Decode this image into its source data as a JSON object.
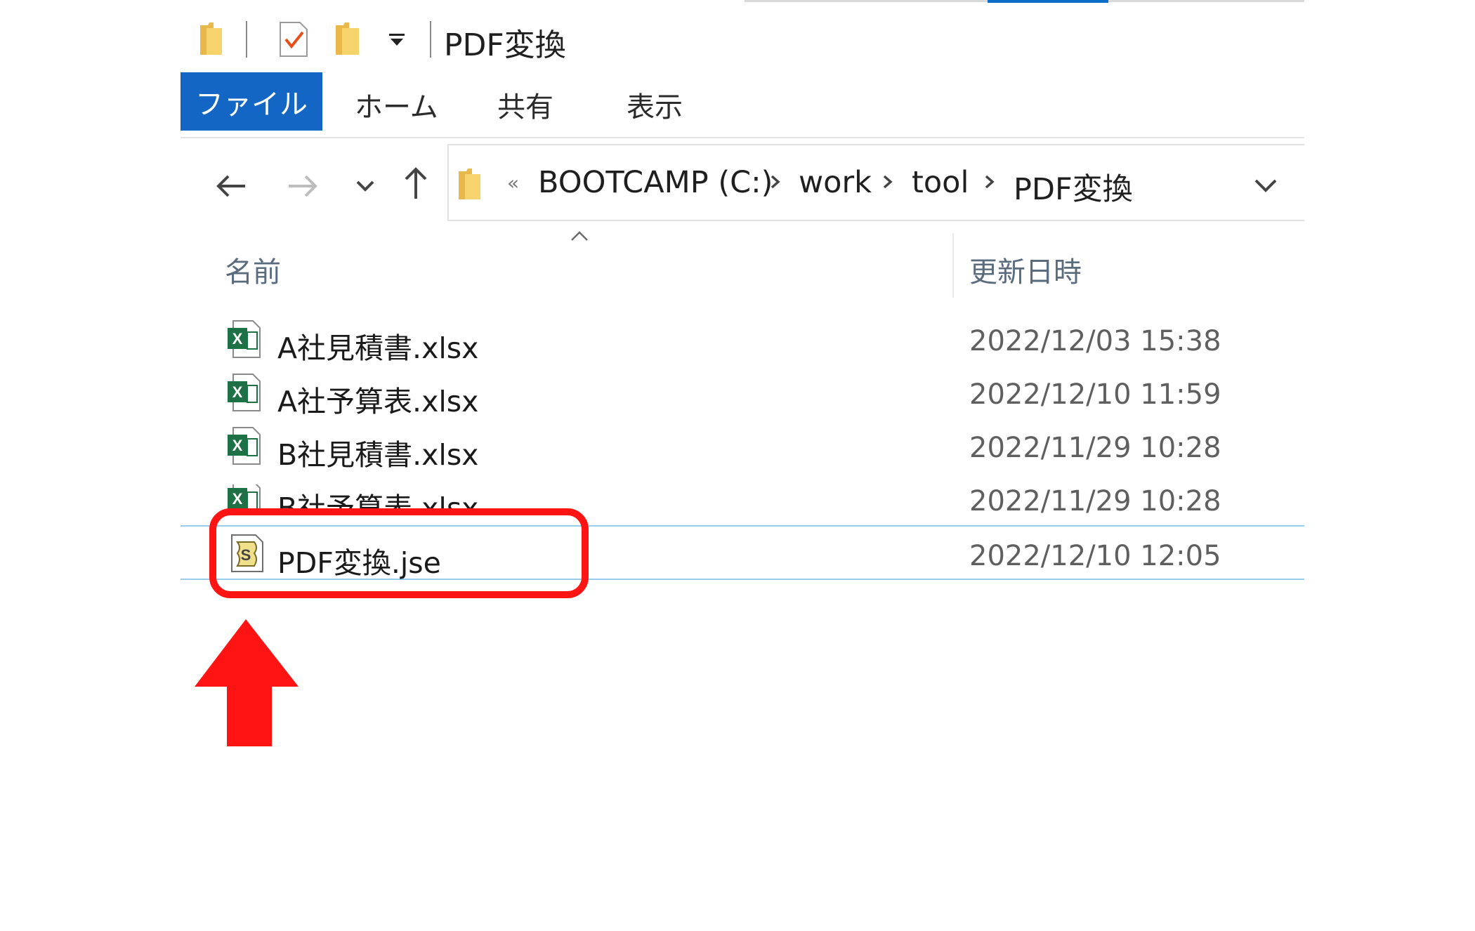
{
  "window": {
    "title": "PDF変換",
    "colors": {
      "accent": "#1366c3",
      "highlight": "#ff1414",
      "selection_border": "#99cdf0"
    }
  },
  "quick_access": {
    "icons": [
      "folder-icon",
      "properties-check-icon",
      "new-folder-icon",
      "dropdown-caret-icon"
    ]
  },
  "ribbon": {
    "tabs": [
      {
        "label": "ファイル",
        "active": true
      },
      {
        "label": "ホーム"
      },
      {
        "label": "共有"
      },
      {
        "label": "表示"
      }
    ]
  },
  "nav": {
    "icons": [
      "back-arrow-icon",
      "forward-arrow-icon",
      "recent-dropdown-icon",
      "up-arrow-icon"
    ]
  },
  "address_bar": {
    "overflow": "«",
    "crumbs": [
      "BOOTCAMP (C:)",
      "work",
      "tool",
      "PDF変換"
    ]
  },
  "columns": {
    "name": "名前",
    "modified": "更新日時"
  },
  "files": [
    {
      "name": "A社見積書.xlsx",
      "modified": "2022/12/03 15:38",
      "type": "excel"
    },
    {
      "name": "A社予算表.xlsx",
      "modified": "2022/12/10 11:59",
      "type": "excel"
    },
    {
      "name": "B社見積書.xlsx",
      "modified": "2022/11/29 10:28",
      "type": "excel"
    },
    {
      "name": "B社予算表.xlsx",
      "modified": "2022/11/29 10:28",
      "type": "excel"
    },
    {
      "name": "PDF変換.jse",
      "modified": "2022/12/10 12:05",
      "type": "script",
      "selected": true
    }
  ]
}
